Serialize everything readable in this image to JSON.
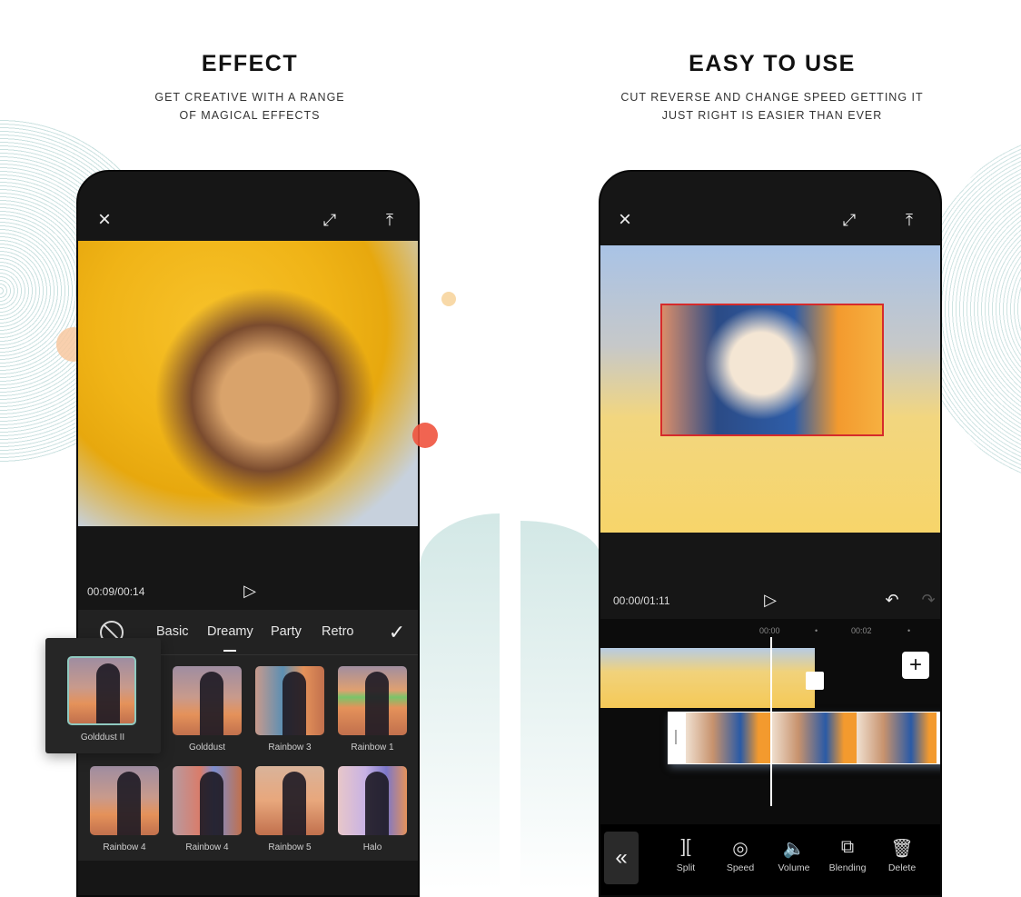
{
  "panels": [
    {
      "title": "EFFECT",
      "subtitle_lines": [
        "GET CREATIVE WITH A RANGE",
        "OF MAGICAL EFFECTS"
      ]
    },
    {
      "title": "EASY TO USE",
      "subtitle_lines": [
        "CUT REVERSE AND CHANGE SPEED GETTING IT",
        "JUST RIGHT IS EASIER THAN EVER"
      ]
    }
  ],
  "effect_screen": {
    "topbar": {
      "close_icon": "×",
      "fullscreen_icon": "⤢",
      "export_icon": "⤒"
    },
    "time_display": "00:09/00:14",
    "play_icon": "▷",
    "no_effect_icon": "⃠",
    "confirm_icon": "✓",
    "categories": [
      {
        "label": "Basic",
        "active": false
      },
      {
        "label": "Dreamy",
        "active": true
      },
      {
        "label": "Party",
        "active": false
      },
      {
        "label": "Retro",
        "active": false
      }
    ],
    "selected_effect": "Golddust II",
    "effects": [
      "Golddust",
      "Rainbow 3",
      "Rainbow 1",
      "Rainbow 4",
      "Rainbow 4",
      "Rainbow 5",
      "Halo"
    ]
  },
  "editor_screen": {
    "topbar": {
      "close_icon": "×",
      "fullscreen_icon": "⤢",
      "export_icon": "⤒"
    },
    "time_display": "00:00/01:11",
    "play_icon": "▷",
    "undo_icon": "↶",
    "redo_icon": "↷",
    "ruler": [
      "00:00",
      "•",
      "00:02",
      "•"
    ],
    "add_icon": "+",
    "collapse_icon": "«",
    "tools": [
      {
        "icon": "][",
        "label": "Split"
      },
      {
        "icon": "◎",
        "label": "Speed"
      },
      {
        "icon": "🔈",
        "label": "Volume"
      },
      {
        "icon": "⧉",
        "label": "Blending"
      },
      {
        "icon": "🗑",
        "label": "Delete"
      }
    ]
  },
  "colors": {
    "accent_teal": "#8fc9c0",
    "overlay_border": "#d62b2b",
    "dot_orange": "#f8c8a0",
    "dot_red": "#f0533e"
  }
}
